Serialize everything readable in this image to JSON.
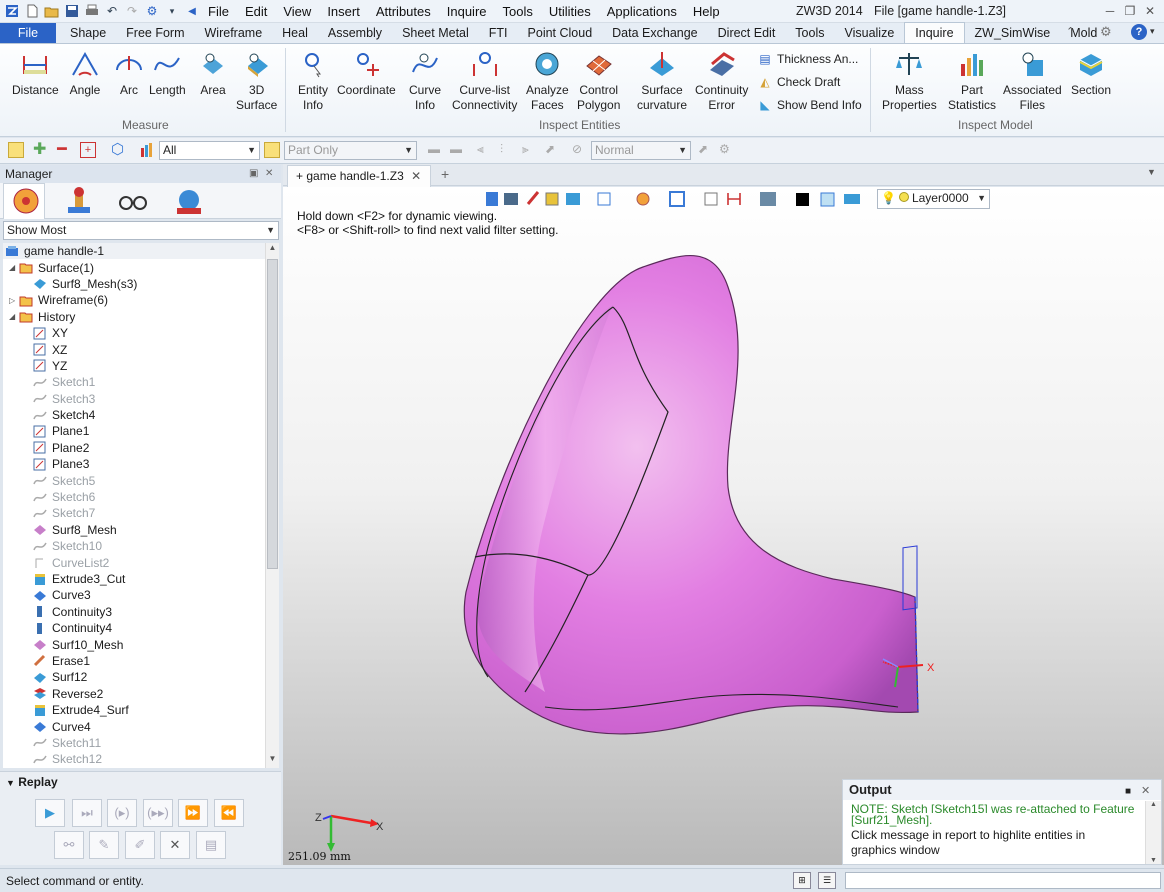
{
  "app": {
    "title": "ZW3D 2014",
    "file": "File [game handle-1.Z3]"
  },
  "menu": [
    "File",
    "Edit",
    "View",
    "Insert",
    "Attributes",
    "Inquire",
    "Tools",
    "Utilities",
    "Applications",
    "Help"
  ],
  "tabs": [
    "File",
    "Shape",
    "Free Form",
    "Wireframe",
    "Heal",
    "Assembly",
    "Sheet Metal",
    "FTI",
    "Point Cloud",
    "Data Exchange",
    "Direct Edit",
    "Tools",
    "Visualize",
    "Inquire",
    "ZW_SimWise",
    "Mold"
  ],
  "active_tab": "Inquire",
  "ribbon": {
    "measure": {
      "label": "Measure",
      "buttons": [
        [
          "Distance",
          ""
        ],
        [
          "Angle",
          ""
        ],
        [
          "Arc",
          ""
        ],
        [
          "Length",
          ""
        ],
        [
          "Area",
          ""
        ],
        [
          "3D",
          "Surface"
        ]
      ]
    },
    "inspect": {
      "label": "Inspect Entities",
      "buttons": [
        [
          "Entity",
          "Info"
        ],
        [
          "Coordinate",
          ""
        ],
        [
          "Curve",
          "Info"
        ],
        [
          "Curve-list",
          "Connectivity"
        ],
        [
          "Analyze",
          "Faces"
        ],
        [
          "Control",
          "Polygon"
        ],
        [
          "Surface",
          "curvature"
        ],
        [
          "Continuity",
          "Error"
        ]
      ],
      "small": [
        "Thickness An...",
        "Check Draft",
        "Show Bend Info"
      ]
    },
    "model": {
      "label": "Inspect Model",
      "buttons": [
        [
          "Mass",
          "Properties"
        ],
        [
          "Part",
          "Statistics"
        ],
        [
          "Associated",
          "Files"
        ],
        [
          "Section",
          ""
        ]
      ]
    }
  },
  "toolbar2": {
    "filter": "All",
    "scope": "Part Only",
    "mode": "Normal"
  },
  "manager": {
    "title": "Manager",
    "filter": "Show Most"
  },
  "tree": [
    {
      "label": "game handle-1",
      "lvl": 0,
      "icon": "part",
      "dim": false
    },
    {
      "label": "Surface(1)",
      "lvl": 1,
      "icon": "folder",
      "dim": false,
      "exp": "open"
    },
    {
      "label": "Surf8_Mesh(s3)",
      "lvl": 2,
      "icon": "surf",
      "dim": false
    },
    {
      "label": "Wireframe(6)",
      "lvl": 1,
      "icon": "folder",
      "dim": false,
      "exp": "closed"
    },
    {
      "label": "History",
      "lvl": 1,
      "icon": "folder",
      "dim": false,
      "exp": "open"
    },
    {
      "label": "XY",
      "lvl": 2,
      "icon": "plane",
      "dim": false
    },
    {
      "label": "XZ",
      "lvl": 2,
      "icon": "plane",
      "dim": false
    },
    {
      "label": "YZ",
      "lvl": 2,
      "icon": "plane",
      "dim": false
    },
    {
      "label": "Sketch1",
      "lvl": 2,
      "icon": "sketch",
      "dim": true
    },
    {
      "label": "Sketch3",
      "lvl": 2,
      "icon": "sketch",
      "dim": true
    },
    {
      "label": "Sketch4",
      "lvl": 2,
      "icon": "sketch",
      "dim": false
    },
    {
      "label": "Plane1",
      "lvl": 2,
      "icon": "plane",
      "dim": false
    },
    {
      "label": "Plane2",
      "lvl": 2,
      "icon": "plane",
      "dim": false
    },
    {
      "label": "Plane3",
      "lvl": 2,
      "icon": "plane",
      "dim": false
    },
    {
      "label": "Sketch5",
      "lvl": 2,
      "icon": "sketch",
      "dim": true
    },
    {
      "label": "Sketch6",
      "lvl": 2,
      "icon": "sketch",
      "dim": true
    },
    {
      "label": "Sketch7",
      "lvl": 2,
      "icon": "sketch",
      "dim": true
    },
    {
      "label": "Surf8_Mesh",
      "lvl": 2,
      "icon": "mesh",
      "dim": false
    },
    {
      "label": "Sketch10",
      "lvl": 2,
      "icon": "sketch",
      "dim": true
    },
    {
      "label": "CurveList2",
      "lvl": 2,
      "icon": "curvelist",
      "dim": true
    },
    {
      "label": "Extrude3_Cut",
      "lvl": 2,
      "icon": "extrude",
      "dim": false
    },
    {
      "label": "Curve3",
      "lvl": 2,
      "icon": "curve",
      "dim": false
    },
    {
      "label": "Continuity3",
      "lvl": 2,
      "icon": "cont",
      "dim": false
    },
    {
      "label": "Continuity4",
      "lvl": 2,
      "icon": "cont",
      "dim": false
    },
    {
      "label": "Surf10_Mesh",
      "lvl": 2,
      "icon": "mesh",
      "dim": false
    },
    {
      "label": "Erase1",
      "lvl": 2,
      "icon": "erase",
      "dim": false
    },
    {
      "label": "Surf12",
      "lvl": 2,
      "icon": "surf",
      "dim": false
    },
    {
      "label": "Reverse2",
      "lvl": 2,
      "icon": "reverse",
      "dim": false
    },
    {
      "label": "Extrude4_Surf",
      "lvl": 2,
      "icon": "extrude",
      "dim": false
    },
    {
      "label": "Curve4",
      "lvl": 2,
      "icon": "curve",
      "dim": false
    },
    {
      "label": "Sketch11",
      "lvl": 2,
      "icon": "sketch",
      "dim": true
    },
    {
      "label": "Sketch12",
      "lvl": 2,
      "icon": "sketch",
      "dim": true
    }
  ],
  "replay": {
    "title": "Replay"
  },
  "doc": {
    "tab": "game handle-1.Z3",
    "layer": "Layer0000"
  },
  "hint": [
    "Hold down <F2> for dynamic viewing.",
    "<F8> or <Shift-roll> to find next valid filter setting."
  ],
  "scale": "251.09 mm",
  "axes": {
    "x": "X",
    "y": "Y",
    "z": "Z"
  },
  "output": {
    "title": "Output",
    "lines": [
      "NOTE: Sketch [Sketch15] was re-attached to Feature",
      "[Surf21_Mesh].",
      "Click message in report to highlite entities in",
      "graphics window"
    ]
  },
  "status": "Select command or entity.",
  "colors": {
    "model": "#e07de0",
    "file_tab": "#2b63c6",
    "note": "#2b8a2b"
  }
}
